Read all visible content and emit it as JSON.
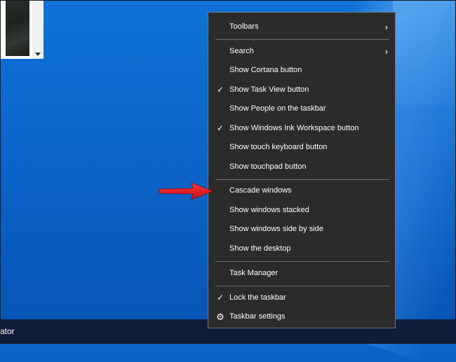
{
  "taskbar": {
    "left_item_text": "ator"
  },
  "context_menu": {
    "items": [
      {
        "label": "Toolbars",
        "checked": false,
        "submenu": true
      },
      {
        "label": "Search",
        "checked": false,
        "submenu": true
      },
      {
        "label": "Show Cortana button",
        "checked": false,
        "submenu": false
      },
      {
        "label": "Show Task View button",
        "checked": true,
        "submenu": false
      },
      {
        "label": "Show People on the taskbar",
        "checked": false,
        "submenu": false
      },
      {
        "label": "Show Windows Ink Workspace button",
        "checked": true,
        "submenu": false
      },
      {
        "label": "Show touch keyboard button",
        "checked": false,
        "submenu": false
      },
      {
        "label": "Show touchpad button",
        "checked": false,
        "submenu": false
      },
      {
        "label": "Cascade windows",
        "checked": false,
        "submenu": false
      },
      {
        "label": "Show windows stacked",
        "checked": false,
        "submenu": false
      },
      {
        "label": "Show windows side by side",
        "checked": false,
        "submenu": false
      },
      {
        "label": "Show the desktop",
        "checked": false,
        "submenu": false
      },
      {
        "label": "Task Manager",
        "checked": false,
        "submenu": false
      },
      {
        "label": "Lock the taskbar",
        "checked": true,
        "submenu": false
      },
      {
        "label": "Taskbar settings",
        "checked": false,
        "submenu": false,
        "icon": "gear-icon"
      }
    ],
    "glyphs": {
      "check": "✓",
      "chevron": "›",
      "gear": "⚙"
    }
  },
  "colors": {
    "menu_background": "#2b2b2b",
    "menu_text": "#ffffff",
    "desktop_blue": "#0a64c8",
    "taskbar": "#101c3a",
    "annotation_arrow": "#e0141e"
  }
}
